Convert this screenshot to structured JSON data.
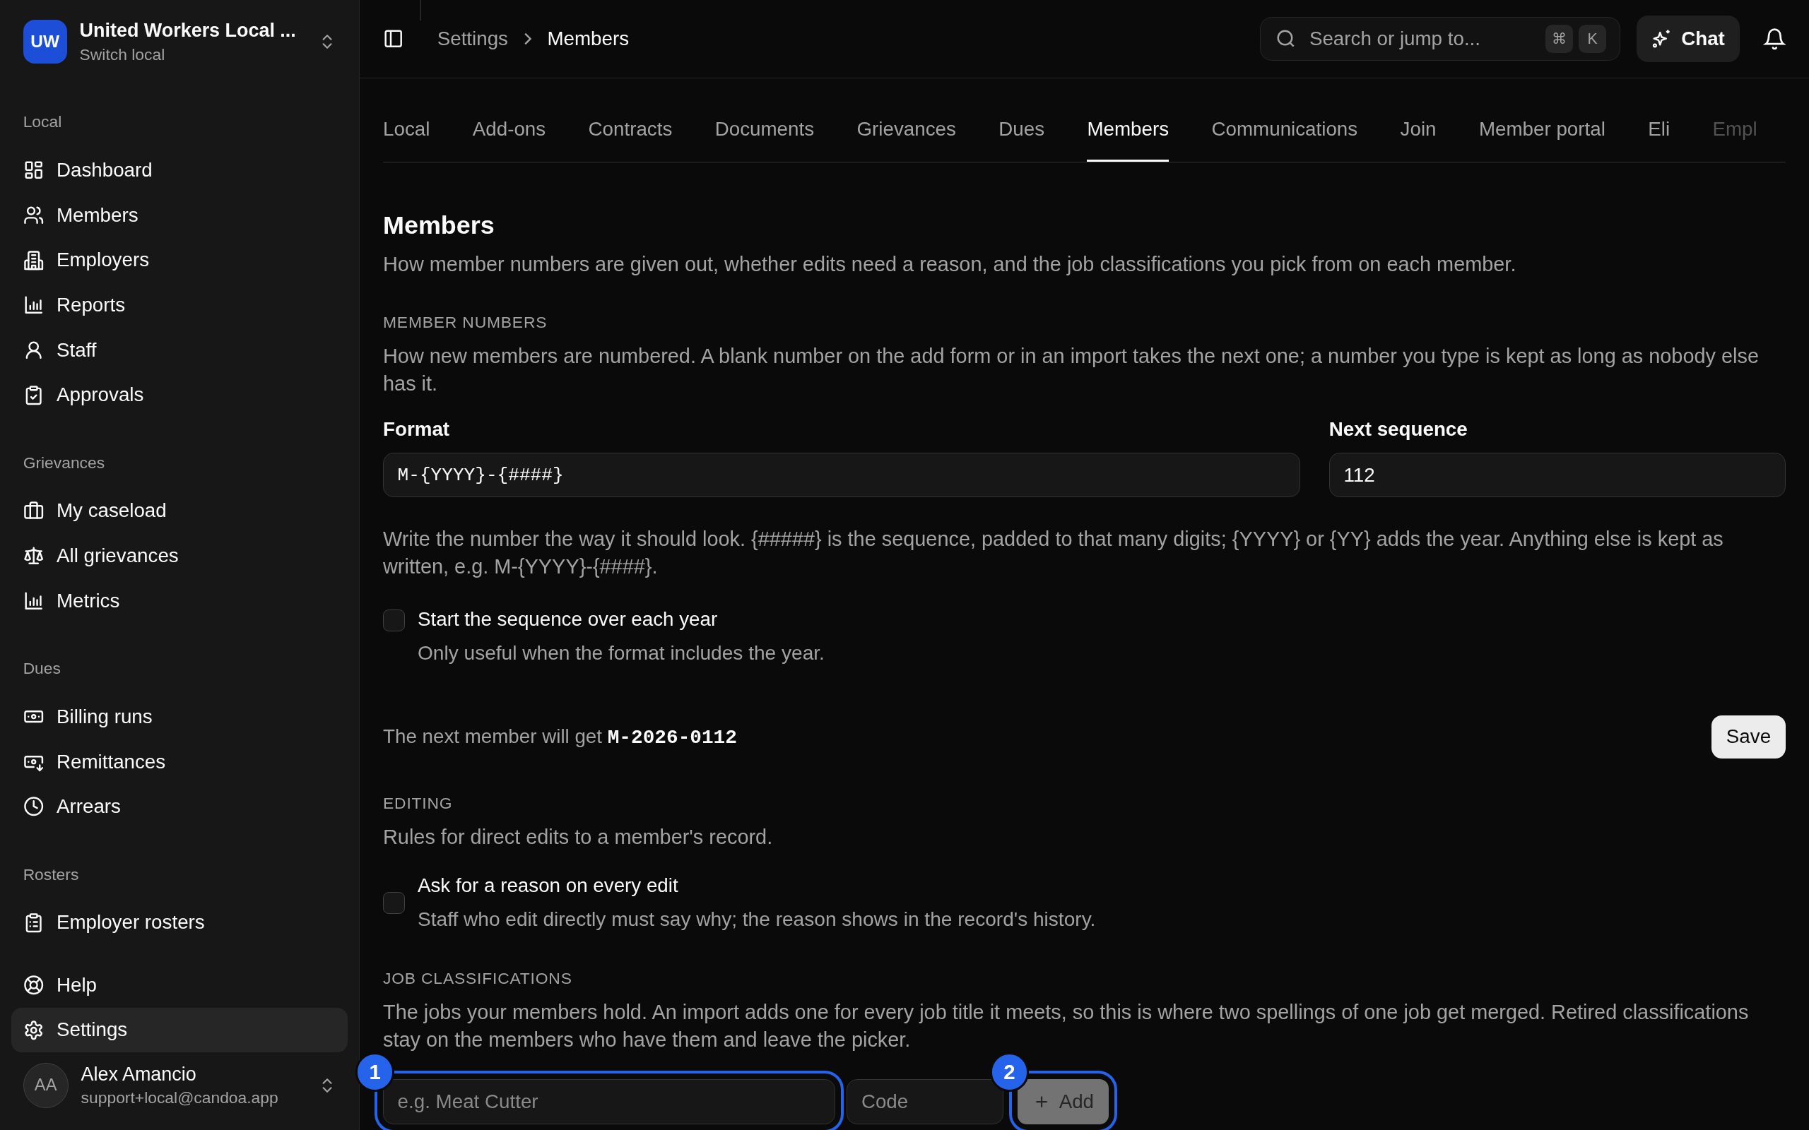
{
  "sidebar": {
    "org": {
      "initials": "UW",
      "name": "United Workers Local ...",
      "subtitle": "Switch local"
    },
    "sections": [
      {
        "title": "Local",
        "items": [
          {
            "label": "Dashboard",
            "selected": false
          },
          {
            "label": "Members",
            "selected": false
          },
          {
            "label": "Employers",
            "selected": false
          },
          {
            "label": "Reports",
            "selected": false
          },
          {
            "label": "Staff",
            "selected": false
          },
          {
            "label": "Approvals",
            "selected": false
          }
        ]
      },
      {
        "title": "Grievances",
        "items": [
          {
            "label": "My caseload",
            "selected": false
          },
          {
            "label": "All grievances",
            "selected": false
          },
          {
            "label": "Metrics",
            "selected": false
          }
        ]
      },
      {
        "title": "Dues",
        "items": [
          {
            "label": "Billing runs",
            "selected": false
          },
          {
            "label": "Remittances",
            "selected": false
          },
          {
            "label": "Arrears",
            "selected": false
          }
        ]
      },
      {
        "title": "Rosters",
        "items": [
          {
            "label": "Employer rosters",
            "selected": false
          }
        ]
      }
    ],
    "footer_items": [
      {
        "label": "Help",
        "selected": false
      },
      {
        "label": "Settings",
        "selected": true
      }
    ],
    "user": {
      "initials": "AA",
      "name": "Alex Amancio",
      "email": "support+local@candoa.app"
    }
  },
  "topbar": {
    "breadcrumb": [
      "Settings",
      "Members"
    ],
    "search": {
      "placeholder": "Search or jump to...",
      "keys": [
        "⌘",
        "K"
      ]
    },
    "chat_button": "Chat"
  },
  "tabs": [
    {
      "label": "Local",
      "selected": false
    },
    {
      "label": "Add-ons",
      "selected": false
    },
    {
      "label": "Contracts",
      "selected": false
    },
    {
      "label": "Documents",
      "selected": false
    },
    {
      "label": "Grievances",
      "selected": false
    },
    {
      "label": "Dues",
      "selected": false
    },
    {
      "label": "Members",
      "selected": true
    },
    {
      "label": "Communications",
      "selected": false
    },
    {
      "label": "Join",
      "selected": false
    },
    {
      "label": "Member portal",
      "selected": false
    },
    {
      "label": "Eli",
      "selected": false
    },
    {
      "label": "Empl",
      "selected": false
    }
  ],
  "page": {
    "title": "Members",
    "description": "How member numbers are given out, whether edits need a reason, and the job classifications you pick from on each member."
  },
  "member_numbers": {
    "heading": "MEMBER NUMBERS",
    "description": "How new members are numbered. A blank number on the add form or in an import takes the next one; a number you type is kept as long as nobody else has it.",
    "format": {
      "label": "Format",
      "value": "M-{YYYY}-{####}"
    },
    "next_sequence": {
      "label": "Next sequence",
      "value": "112"
    },
    "help": "Write the number the way it should look. {#####} is the sequence, padded to that many digits; {YYYY} or {YY} adds the year. Anything else is kept as written, e.g. M-{YYYY}-{####}.",
    "reset_yearly": {
      "label": "Start the sequence over each year",
      "hint": "Only useful when the format includes the year.",
      "checked": false
    },
    "preview": "The next member will get **M-2026-0112**",
    "save_button": "Save"
  },
  "editing": {
    "heading": "EDITING",
    "description": "Rules for direct edits to a member's record.",
    "require_reason": {
      "label": "Ask for a reason on every edit",
      "hint": "Staff who edit directly must say why; the reason shows in the record's history.",
      "checked": false
    }
  },
  "job_classifications": {
    "heading": "JOB CLASSIFICATIONS",
    "description": "The jobs your members hold. An import adds one for every job title it meets, so this is where two spellings of one job get merged. Retired classifications stay on the members who have them and leave the picker.",
    "name_field": {
      "placeholder": "e.g. Meat Cutter",
      "annotation": "1"
    },
    "code_field": {
      "placeholder": "Code"
    },
    "add_button": {
      "label": "Add",
      "disabled": true,
      "annotation": "2"
    }
  }
}
